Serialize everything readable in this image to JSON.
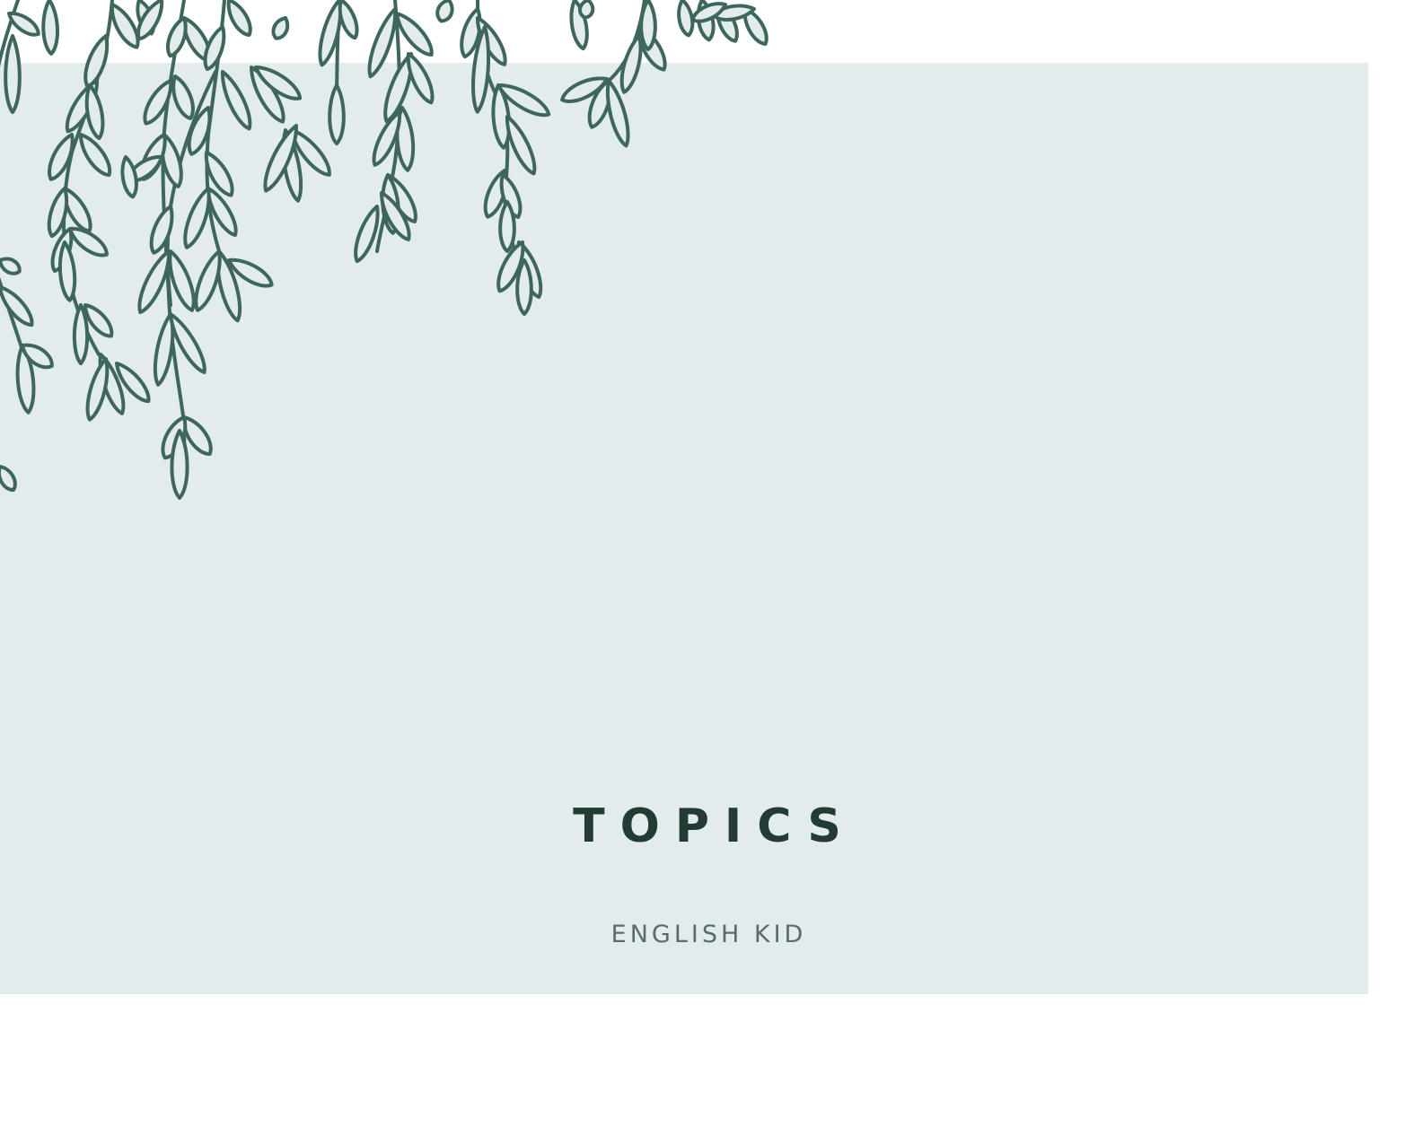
{
  "slide": {
    "title": "TOPICS",
    "subtitle": "ENGLISH KID"
  },
  "colors": {
    "panel": "#e2ecec",
    "foliage": "#3e665d",
    "title": "#233a35",
    "subtitle": "#5e6a69",
    "background": "#ffffff"
  },
  "decoration": {
    "icon": "hanging-willow-leaves-icon"
  }
}
